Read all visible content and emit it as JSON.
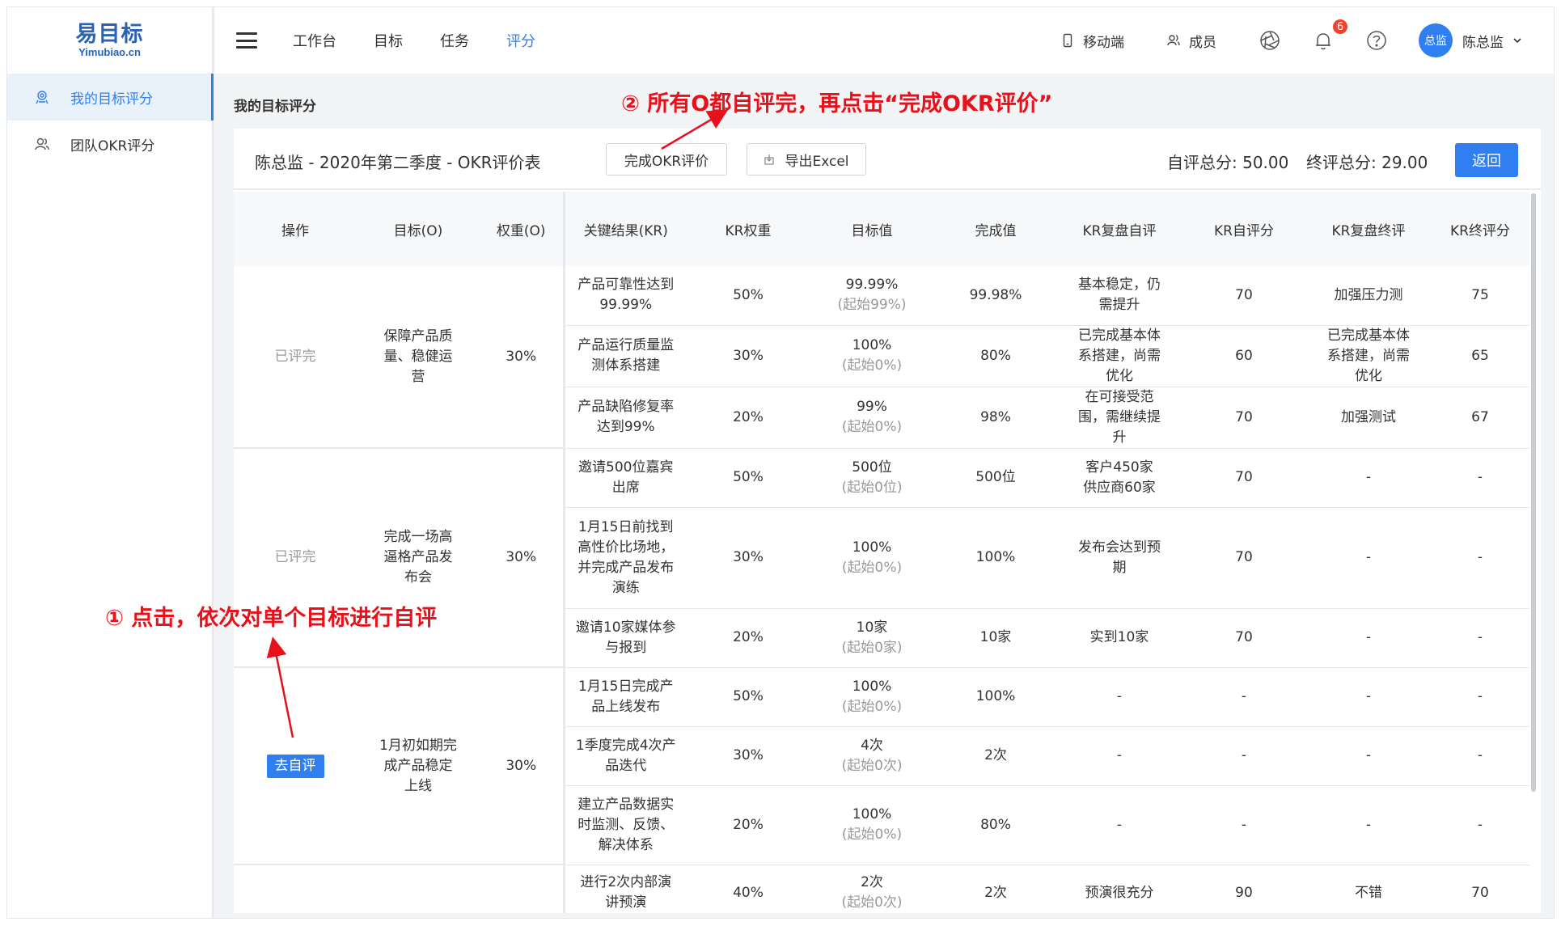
{
  "app": {
    "logo_main": "易目标",
    "logo_sub": "Yimubiao.cn"
  },
  "sidebar": {
    "items": [
      {
        "label": "我的目标评分",
        "icon": "user-badge-icon",
        "active": true
      },
      {
        "label": "团队OKR评分",
        "icon": "team-icon",
        "active": false
      }
    ]
  },
  "topnav": {
    "items": [
      {
        "label": "工作台",
        "active": false
      },
      {
        "label": "目标",
        "active": false
      },
      {
        "label": "任务",
        "active": false
      },
      {
        "label": "评分",
        "active": true
      }
    ],
    "mobile_label": "移动端",
    "members_label": "成员",
    "notification_count": "6",
    "avatar_text": "总监",
    "user_name": "陈总监"
  },
  "page": {
    "title": "我的目标评分",
    "sheet_title": "陈总监 - 2020年第二季度 - OKR评价表",
    "finish_button": "完成OKR评价",
    "export_button": "导出Excel",
    "self_total": "自评总分: 50.00",
    "final_total": "终评总分: 29.00",
    "back_button": "返回"
  },
  "table": {
    "headers": [
      "操作",
      "目标(O)",
      "权重(O)",
      "关键结果(KR)",
      "KR权重",
      "目标值",
      "完成值",
      "KR复盘自评",
      "KR自评分",
      "KR复盘终评",
      "KR终评分"
    ],
    "objectives": [
      {
        "action": "已评完",
        "action_type": "done",
        "objective": "保障产品质量、稳健运营",
        "weight": "30%",
        "krs": [
          {
            "kr": "产品可靠性达到99.99%",
            "kr_weight": "50%",
            "target": "99.99%",
            "target_start": "(起始99%)",
            "actual": "99.98%",
            "self_review": "基本稳定，仍需提升",
            "self_score": "70",
            "final_review": "加强压力测",
            "final_score": "75"
          },
          {
            "kr": "产品运行质量监测体系搭建",
            "kr_weight": "30%",
            "target": "100%",
            "target_start": "(起始0%)",
            "actual": "80%",
            "self_review": "已完成基本体系搭建，尚需优化",
            "self_score": "60",
            "final_review": "已完成基本体系搭建，尚需优化",
            "final_score": "65"
          },
          {
            "kr": "产品缺陷修复率达到99%",
            "kr_weight": "20%",
            "target": "99%",
            "target_start": "(起始0%)",
            "actual": "98%",
            "self_review": "在可接受范围，需继续提升",
            "self_score": "70",
            "final_review": "加强测试",
            "final_score": "67"
          }
        ]
      },
      {
        "action": "已评完",
        "action_type": "done",
        "objective": "完成一场高逼格产品发布会",
        "weight": "30%",
        "krs": [
          {
            "kr": "邀请500位嘉宾出席",
            "kr_weight": "50%",
            "target": "500位",
            "target_start": "(起始0位)",
            "actual": "500位",
            "self_review": "客户450家 供应商60家",
            "self_score": "70",
            "final_review": "-",
            "final_score": "-"
          },
          {
            "kr": "1月15日前找到高性价比场地，并完成产品发布演练",
            "kr_weight": "30%",
            "target": "100%",
            "target_start": "(起始0%)",
            "actual": "100%",
            "self_review": "发布会达到预期",
            "self_score": "70",
            "final_review": "-",
            "final_score": "-"
          },
          {
            "kr": "邀请10家媒体参与报到",
            "kr_weight": "20%",
            "target": "10家",
            "target_start": "(起始0家)",
            "actual": "10家",
            "self_review": "实到10家",
            "self_score": "70",
            "final_review": "-",
            "final_score": "-"
          }
        ]
      },
      {
        "action": "去自评",
        "action_type": "button",
        "objective": "1月初如期完成产品稳定上线",
        "weight": "30%",
        "krs": [
          {
            "kr": "1月15日完成产品上线发布",
            "kr_weight": "50%",
            "target": "100%",
            "target_start": "(起始0%)",
            "actual": "100%",
            "self_review": "-",
            "self_score": "-",
            "final_review": "-",
            "final_score": "-"
          },
          {
            "kr": "1季度完成4次产品迭代",
            "kr_weight": "30%",
            "target": "4次",
            "target_start": "(起始0次)",
            "actual": "2次",
            "self_review": "-",
            "self_score": "-",
            "final_review": "-",
            "final_score": "-"
          },
          {
            "kr": "建立产品数据实时监测、反馈、解决体系",
            "kr_weight": "20%",
            "target": "100%",
            "target_start": "(起始0%)",
            "actual": "80%",
            "self_review": "-",
            "self_score": "-",
            "final_review": "-",
            "final_score": "-"
          }
        ]
      },
      {
        "action": "",
        "action_type": "none",
        "objective": "",
        "weight": "",
        "krs": [
          {
            "kr": "进行2次内部演讲预演",
            "kr_weight": "40%",
            "target": "2次",
            "target_start": "(起始0次)",
            "actual": "2次",
            "self_review": "预演很充分",
            "self_score": "90",
            "final_review": "不错",
            "final_score": "70"
          }
        ]
      }
    ]
  },
  "annotations": {
    "step1": "① 点击，依次对单个目标进行自评",
    "step2": "② 所有O都自评完，再点击“完成OKR评价”",
    "color": "#e8101a"
  },
  "colors": {
    "accent": "#2f7ff0",
    "annotation": "#e8101a",
    "badge": "#f0432c"
  }
}
